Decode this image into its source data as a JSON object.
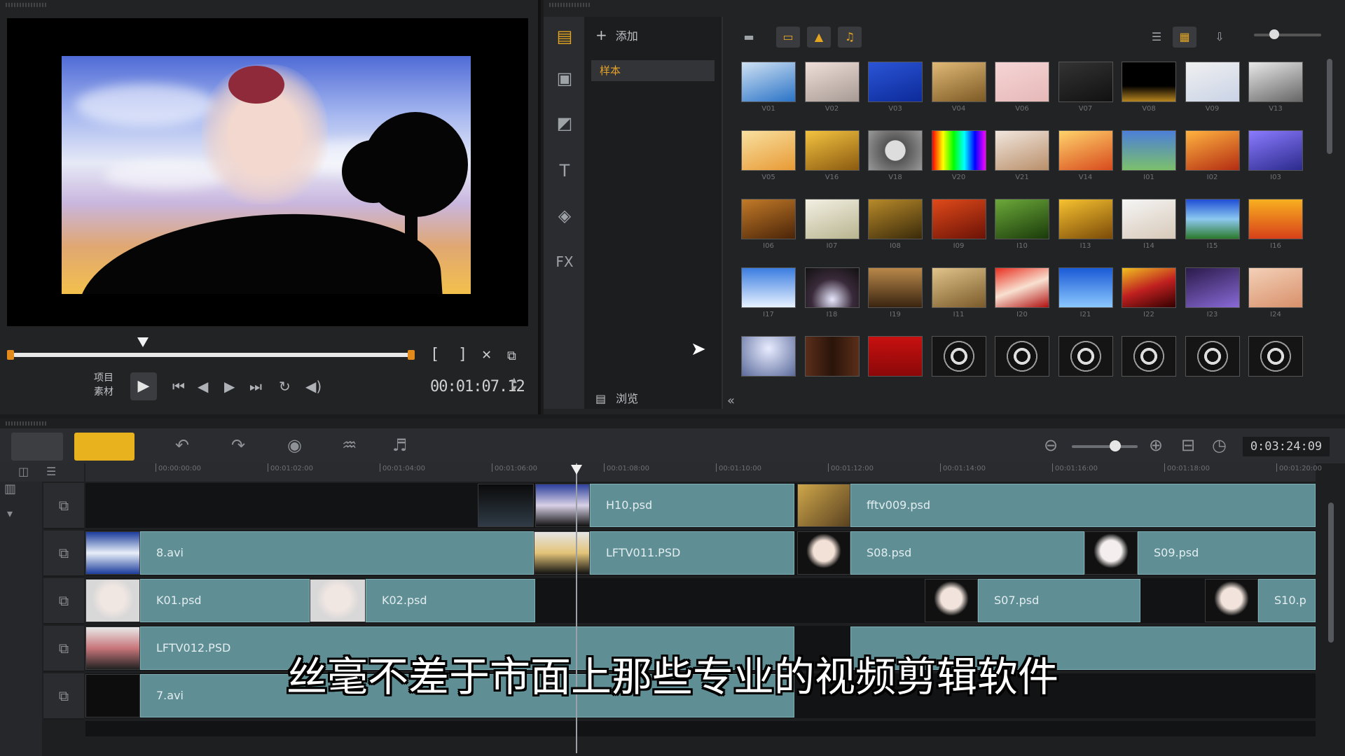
{
  "preview": {
    "mode_labels": [
      "项目",
      "素材"
    ],
    "timecode": "00:01:07.12",
    "trim_in": "[",
    "trim_out": "]"
  },
  "library": {
    "add_label": "添加",
    "folder": "样本",
    "browse_label": "浏览",
    "thumb_labels": [
      "V01",
      "V02",
      "V03",
      "V04",
      "V06",
      "V07",
      "V08",
      "V09",
      "V13",
      "V05",
      "V16",
      "V18",
      "V20",
      "V21",
      "V14",
      "I01",
      "I02",
      "I03",
      "I06",
      "I07",
      "I08",
      "I09",
      "I10",
      "I13",
      "I14",
      "I15",
      "I16",
      "I17",
      "I18",
      "I19",
      "I11",
      "I20",
      "I21",
      "I22",
      "I23",
      "I24"
    ]
  },
  "timeline": {
    "duration": "0:03:24:09",
    "ruler_labels": [
      "00:00:00:00",
      "00:01:02:00",
      "00:01:04:00",
      "00:01:06:00",
      "00:01:08:00",
      "00:01:10:00",
      "00:01:12:00",
      "00:01:14:00",
      "00:01:16:00",
      "00:01:18:00",
      "00:01:20:00"
    ],
    "clips": {
      "t1a": "H10.psd",
      "t1b": "fftv009.psd",
      "t2a": "8.avi",
      "t2b": "LFTV011.PSD",
      "t2c": "S08.psd",
      "t2d": "S09.psd",
      "t3a": "K01.psd",
      "t3b": "K02.psd",
      "t3c": "S07.psd",
      "t3d": "S10.p",
      "t4a": "LFTV012.PSD",
      "t5a": "7.avi"
    }
  },
  "subtitle": "丝毫不差于市面上那些专业的视频剪辑软件"
}
